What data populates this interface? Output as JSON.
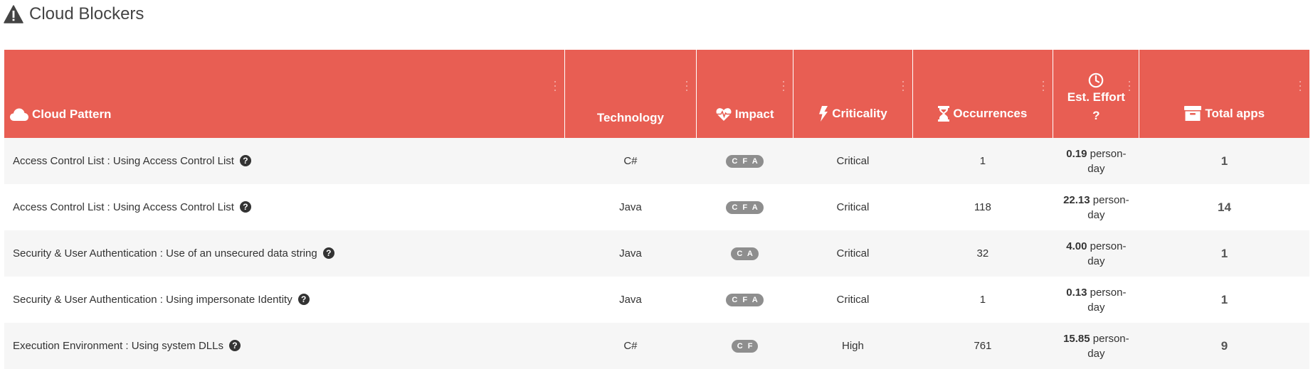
{
  "header": {
    "title": "Cloud Blockers",
    "icon": "warning-triangle-icon"
  },
  "table": {
    "header_color": "#e85e53",
    "columns": {
      "pattern": {
        "label": "Cloud Pattern",
        "icon": "cloud-icon"
      },
      "technology": {
        "label": "Technology"
      },
      "impact": {
        "label": "Impact",
        "icon": "heartbeat-icon"
      },
      "criticality": {
        "label": "Criticality",
        "icon": "lightning-icon"
      },
      "occurrences": {
        "label": "Occurrences",
        "icon": "hourglass-icon"
      },
      "effort": {
        "label": "Est. Effort",
        "icon": "clock-icon",
        "help": "?"
      },
      "apps": {
        "label": "Total apps",
        "icon": "archive-box-icon"
      }
    },
    "rows": [
      {
        "pattern": "Access Control List : Using Access Control List",
        "help": "?",
        "technology": "C#",
        "impact": "C F A",
        "criticality": "Critical",
        "occurrences": "1",
        "effort_value": "0.19",
        "effort_unit": " person-day",
        "apps": "1"
      },
      {
        "pattern": "Access Control List : Using Access Control List",
        "help": "?",
        "technology": "Java",
        "impact": "C F A",
        "criticality": "Critical",
        "occurrences": "118",
        "effort_value": "22.13",
        "effort_unit": " person-day",
        "apps": "14"
      },
      {
        "pattern": "Security & User Authentication : Use of an unsecured data string",
        "help": "?",
        "technology": "Java",
        "impact": "C A",
        "criticality": "Critical",
        "occurrences": "32",
        "effort_value": "4.00",
        "effort_unit": " person-day",
        "apps": "1"
      },
      {
        "pattern": "Security & User Authentication : Using impersonate Identity",
        "help": "?",
        "technology": "Java",
        "impact": "C F A",
        "criticality": "Critical",
        "occurrences": "1",
        "effort_value": "0.13",
        "effort_unit": " person-day",
        "apps": "1"
      },
      {
        "pattern": "Execution Environment : Using system DLLs",
        "help": "?",
        "technology": "C#",
        "impact": "C F",
        "criticality": "High",
        "occurrences": "761",
        "effort_value": "15.85",
        "effort_unit": " person-day",
        "apps": "9"
      }
    ]
  }
}
